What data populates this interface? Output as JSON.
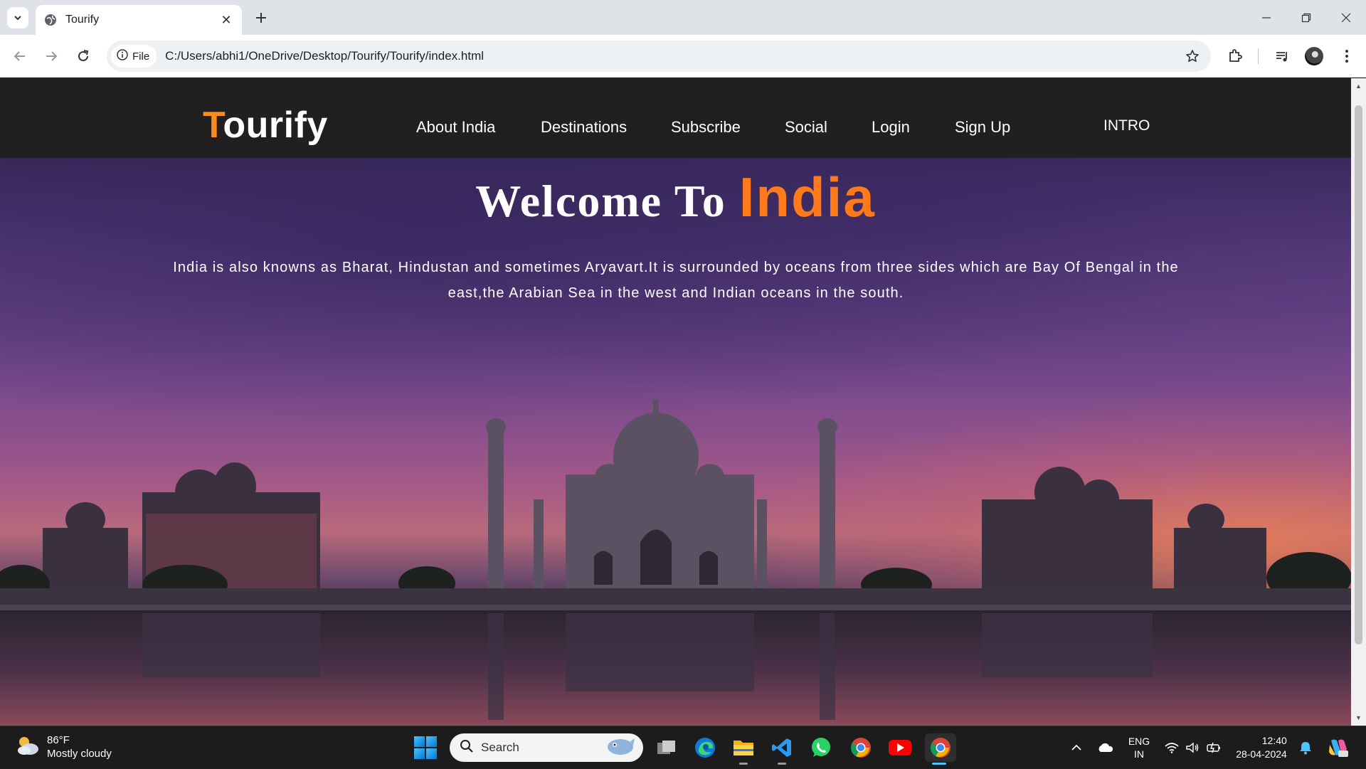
{
  "browser": {
    "tab_title": "Tourify",
    "chip_label": "File",
    "url": "C:/Users/abhi1/OneDrive/Desktop/Tourify/Tourify/index.html"
  },
  "site": {
    "logo_first": "T",
    "logo_rest": "ourify",
    "nav": [
      "About India",
      "Destinations",
      "Subscribe",
      "Social",
      "Login",
      "Sign Up",
      "INTRO"
    ],
    "hero_title_a": "Welcome To",
    "hero_title_b": "India",
    "hero_text": "India is also knowns as Bharat, Hindustan and sometimes Aryavart.It is surrounded by oceans from three sides which are Bay Of Bengal in the east,the Arabian Sea in the west and Indian oceans in the south."
  },
  "taskbar": {
    "weather_temp": "86°F",
    "weather_desc": "Mostly cloudy",
    "search_placeholder": "Search",
    "lang_line1": "ENG",
    "lang_line2": "IN",
    "time": "12:40",
    "date": "28-04-2024"
  },
  "colors": {
    "accent_orange": "#ff7a1a",
    "nav_bg": "#202020",
    "taskbar_bg": "#1c1c1c"
  },
  "icons": [
    "tab-search-icon",
    "globe-icon",
    "close-icon",
    "plus-icon",
    "minimize-icon",
    "restore-icon",
    "window-close-icon",
    "back-icon",
    "forward-icon",
    "reload-icon",
    "info-icon",
    "star-icon",
    "extensions-icon",
    "media-icon",
    "profile-avatar",
    "menu-icon",
    "weather-icon",
    "windows-start-icon",
    "search-icon",
    "task-view-icon",
    "edge-icon",
    "file-explorer-icon",
    "vscode-icon",
    "whatsapp-icon",
    "chrome-icon",
    "youtube-icon",
    "chevron-up-icon",
    "onedrive-icon",
    "wifi-icon",
    "volume-icon",
    "battery-icon",
    "notification-icon",
    "copilot-icon"
  ]
}
